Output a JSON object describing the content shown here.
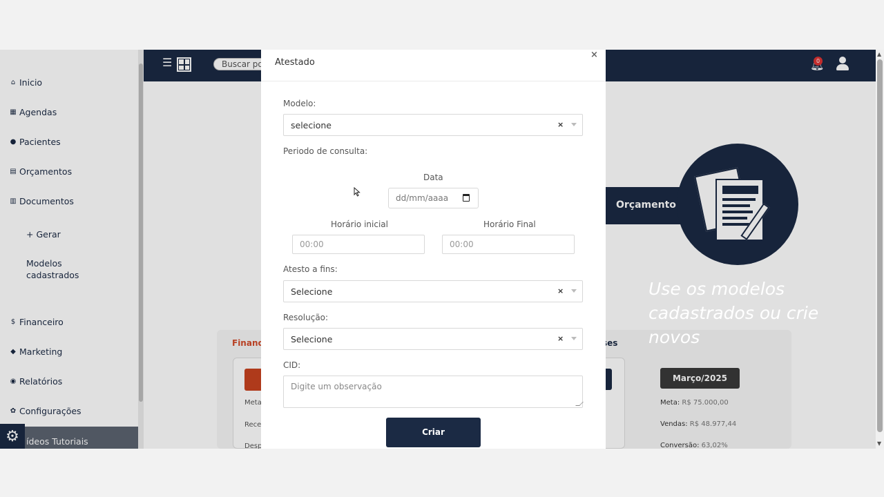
{
  "sidebar": {
    "items": [
      {
        "icon": "home-icon",
        "glyph": "⌂",
        "label": "Inicio"
      },
      {
        "icon": "calendar-icon",
        "glyph": "▦",
        "label": "Agendas"
      },
      {
        "icon": "user-icon",
        "glyph": "●",
        "label": "Pacientes"
      },
      {
        "icon": "file-icon",
        "glyph": "▤",
        "label": "Orçamentos"
      },
      {
        "icon": "files-icon",
        "glyph": "▥",
        "label": "Documentos"
      },
      {
        "icon": "dollar-icon",
        "glyph": "$",
        "label": "Financeiro"
      },
      {
        "icon": "bullhorn-icon",
        "glyph": "◆",
        "label": "Marketing"
      },
      {
        "icon": "chart-icon",
        "glyph": "◉",
        "label": "Relatórios"
      },
      {
        "icon": "gear-icon",
        "glyph": "✿",
        "label": "Configurações"
      }
    ],
    "sub_gerar": "+ Gerar",
    "sub_modelos_1": "Modelos",
    "sub_modelos_2": "cadastrados",
    "video_label": "ídeos Tutoriais"
  },
  "header": {
    "search_placeholder": "Buscar po",
    "notification_count": "0"
  },
  "background": {
    "orcamento_button": "Orçamento R",
    "financeiro_title": "Financ",
    "sessoes_title": "ses",
    "meta_short": "Meta",
    "rece_short": "Rece",
    "desp_short": "Desp",
    "month_label": "Março/2025",
    "meta_label": "Meta:",
    "meta_value": "R$ 75.000,00",
    "vendas_label": "Vendas:",
    "vendas_value": "R$ 48.977,44",
    "conversao_label": "Conversão:",
    "conversao_value": "63,02%"
  },
  "modal": {
    "title": "Atestado",
    "close": "×",
    "modelo_label": "Modelo:",
    "modelo_value": "selecione",
    "periodo_label": "Periodo de consulta:",
    "data_label": "Data",
    "data_placeholder": "dd/mm/aaaa",
    "horario_inicial_label": "Horário inicial",
    "horario_inicial_placeholder": "00:00",
    "horario_final_label": "Horário Final",
    "horario_final_placeholder": "00:00",
    "atesto_label": "Atesto a fins:",
    "atesto_value": "Selecione",
    "resolucao_label": "Resolução:",
    "resolucao_value": "Selecione",
    "cid_label": "CID:",
    "cid_placeholder": "Digite um observação",
    "submit": "Criar",
    "clear_glyph": "×"
  },
  "promo": {
    "line1": "Use os modelos",
    "line2": "cadastrados ou crie",
    "line3": "novos"
  }
}
